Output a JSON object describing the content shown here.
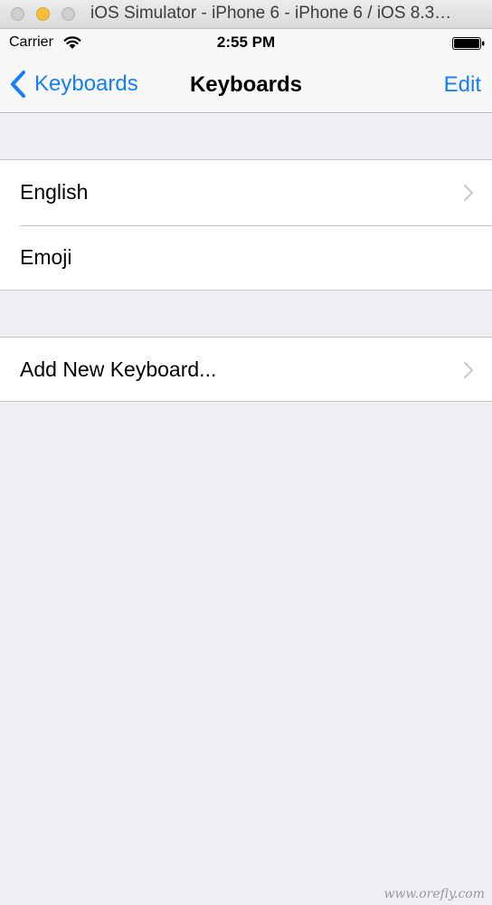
{
  "window": {
    "title": "iOS Simulator - iPhone 6 - iPhone 6 / iOS 8.3…"
  },
  "status_bar": {
    "carrier": "Carrier",
    "time": "2:55 PM"
  },
  "nav_bar": {
    "back_label": "Keyboards",
    "title": "Keyboards",
    "edit_label": "Edit"
  },
  "keyboards": [
    {
      "label": "English",
      "has_chevron": true
    },
    {
      "label": "Emoji",
      "has_chevron": false
    }
  ],
  "add_keyboard": {
    "label": "Add New Keyboard..."
  },
  "watermark": "www.orefly.com",
  "colors": {
    "accent": "#147efb",
    "background": "#efeff4",
    "separator": "#c8c7cc",
    "chevron": "#c7c7cc"
  },
  "icons": {
    "wifi": "wifi-icon",
    "battery": "battery-icon",
    "back": "back-chevron-icon",
    "disclosure": "disclosure-chevron-icon"
  }
}
